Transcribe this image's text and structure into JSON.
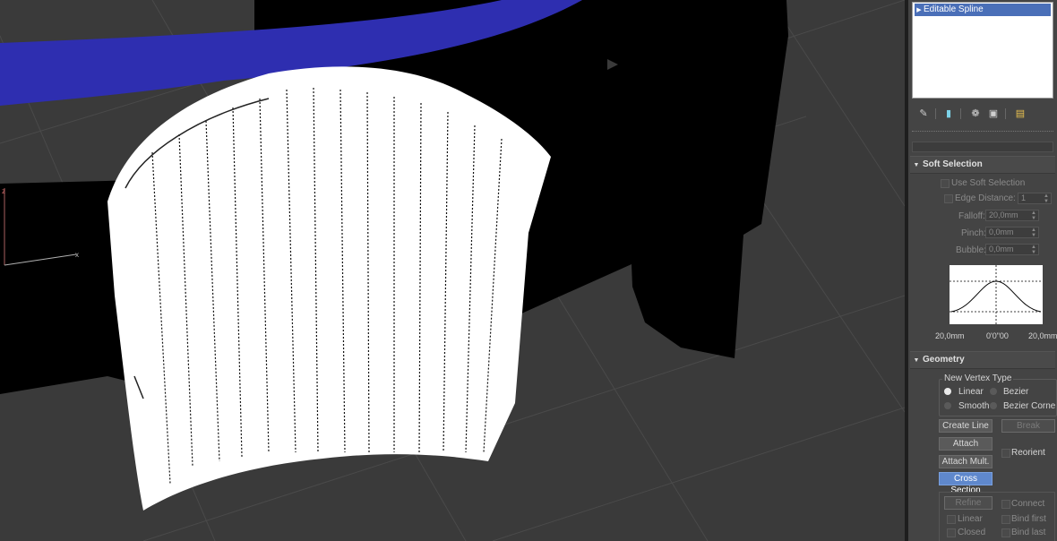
{
  "viewport": {
    "axis_labels": {
      "z": "z",
      "x": "x"
    },
    "colors": {
      "background": "#3a3a3a",
      "blue_ring": "#2e2eb0",
      "dark_object": "#000000",
      "mesh": "#ffffff"
    }
  },
  "modifier_stack": {
    "items": [
      {
        "label": "Editable Spline",
        "selected": true
      }
    ]
  },
  "toolbar_icons": [
    "pin-stack-icon",
    "show-end-result-icon",
    "make-unique-icon",
    "remove-modifier-icon",
    "configure-modifier-sets-icon"
  ],
  "soft_selection": {
    "title": "Soft Selection",
    "use_soft_selection": "Use Soft Selection",
    "edge_distance": {
      "label": "Edge Distance:",
      "value": "1"
    },
    "falloff": {
      "label": "Falloff:",
      "value": "20,0mm"
    },
    "pinch": {
      "label": "Pinch:",
      "value": "0,0mm"
    },
    "bubble": {
      "label": "Bubble:",
      "value": "0,0mm"
    },
    "curve_labels": {
      "left": "20,0mm",
      "center": "0'0\"00",
      "right": "20,0mm"
    }
  },
  "geometry": {
    "title": "Geometry",
    "new_vertex_type": {
      "title": "New Vertex Type",
      "options": [
        {
          "label": "Linear",
          "selected": true
        },
        {
          "label": "Bezier",
          "selected": false
        },
        {
          "label": "Smooth",
          "selected": false
        },
        {
          "label": "Bezier Corne",
          "selected": false
        }
      ]
    },
    "buttons": {
      "create_line": "Create Line",
      "break": "Break",
      "attach": "Attach",
      "reorient": "Reorient",
      "attach_mult": "Attach Mult.",
      "cross_section": "Cross Section",
      "refine": "Refine",
      "connect": "Connect",
      "linear": "Linear",
      "bind_first": "Bind first",
      "closed": "Closed",
      "bind_last": "Bind last"
    }
  }
}
